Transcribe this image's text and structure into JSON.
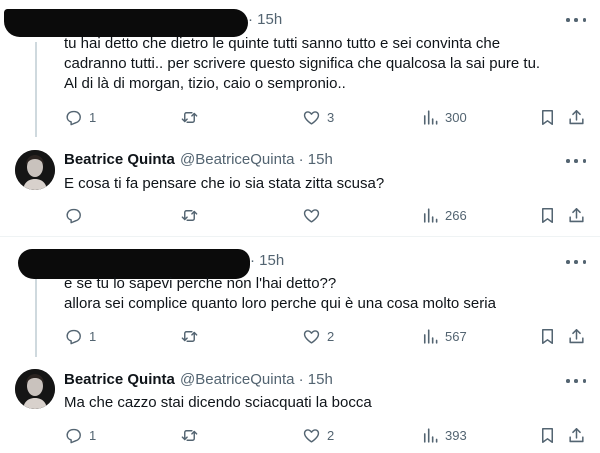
{
  "tweets": [
    {
      "time": "15h",
      "text": "tu hai detto che dietro le quinte tutti sanno tutto e sei convinta che\ncadranno tutti.. per scrivere questo significa che qualcosa la sai pure tu.\nAl di là di morgan, tizio, caio o sempronio..",
      "replies": "1",
      "retweets": "",
      "likes": "3",
      "views": "300"
    },
    {
      "name": "Beatrice Quinta",
      "handle": "@BeatriceQuinta",
      "time": "15h",
      "text": "E cosa ti fa pensare che io sia stata zitta scusa?",
      "replies": "",
      "retweets": "",
      "likes": "",
      "views": "266"
    },
    {
      "time": "15h",
      "text": "e se tu lo sapevi perche non l'hai detto??\nallora sei complice quanto loro perche qui è una cosa molto seria",
      "replies": "1",
      "retweets": "",
      "likes": "2",
      "views": "567"
    },
    {
      "name": "Beatrice Quinta",
      "handle": "@BeatriceQuinta",
      "time": "15h",
      "text": "Ma che cazzo stai dicendo sciacquati la bocca",
      "replies": "1",
      "retweets": "",
      "likes": "2",
      "views": "393"
    }
  ],
  "separator": "·",
  "icons": {
    "reply": "reply-icon",
    "retweet": "retweet-icon",
    "like": "like-icon",
    "views": "views-icon",
    "bookmark": "bookmark-icon",
    "share": "share-icon",
    "more": "more-icon"
  },
  "colors": {
    "text": "#0f1419",
    "secondary": "#536471",
    "thread_line": "#cfd9de",
    "divider": "#eff3f4"
  }
}
